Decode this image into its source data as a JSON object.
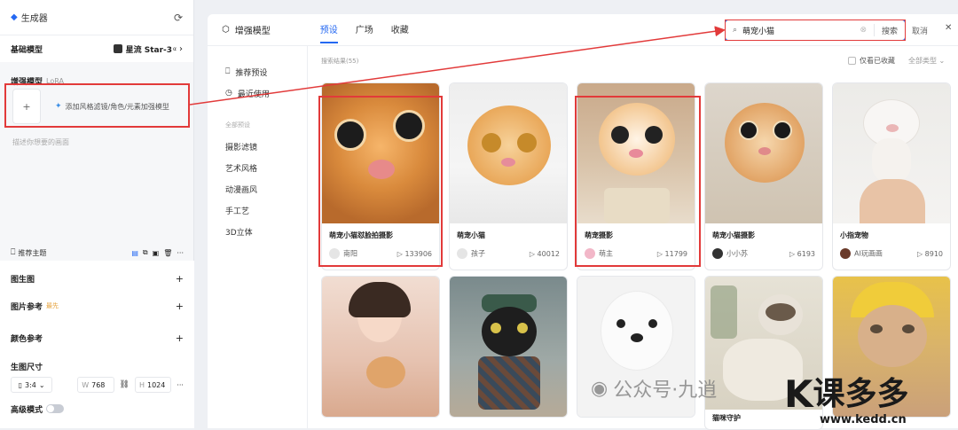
{
  "left_panel": {
    "title": "生成器",
    "base_model_label": "基础模型",
    "base_model_value": "星流 Star-3",
    "base_model_sup": "α",
    "enhance_label": "增强模型",
    "enhance_sub": "LoRA",
    "add_plus": "+",
    "add_model_text": "添加风格滤镜/角色/元素加强模型",
    "prompt_placeholder": "描述你想要的画面",
    "recommend_label": "推荐主题",
    "img2img_label": "图生图",
    "image_ref_label": "图片参考",
    "image_ref_badge": "最先",
    "color_ref_label": "颜色参考",
    "size_label": "生图尺寸",
    "ratio_value": "3:4",
    "w_label": "W",
    "w_value": "768",
    "h_label": "H",
    "h_value": "1024",
    "advanced_label": "高级模式",
    "more": "···"
  },
  "right_panel": {
    "title": "增强模型",
    "tabs": [
      {
        "label": "预设",
        "active": true
      },
      {
        "label": "广场",
        "active": false
      },
      {
        "label": "收藏",
        "active": false
      }
    ],
    "search_value": "萌宠小猫",
    "search_button": "搜索",
    "cancel": "取消",
    "close": "✕",
    "nav": [
      {
        "label": "推荐预设",
        "icon": "bookmark-icon"
      },
      {
        "label": "最近使用",
        "icon": "clock-icon"
      }
    ],
    "nav_group": "全部预设",
    "nav_sub": [
      "摄影滤镜",
      "艺术风格",
      "动漫画风",
      "手工艺",
      "3D立体"
    ],
    "result_count": "搜索结果(55)",
    "only_fav": "仅看已收藏",
    "type_filter": "全部类型"
  },
  "cards_row1": [
    {
      "name": "萌宠小猫怼脸拍摄影",
      "author": "南阳",
      "count": "133906"
    },
    {
      "name": "萌宠小猫",
      "author": "孩子",
      "count": "40012"
    },
    {
      "name": "萌宠摄影",
      "author": "萌主",
      "count": "11799"
    },
    {
      "name": "萌宠小猫摄影",
      "author": "小小苏",
      "count": "6193"
    },
    {
      "name": "小指宠物",
      "author": "AI玩画画",
      "count": "8910"
    }
  ],
  "cards_row2": [
    {
      "name": "",
      "author": "",
      "count": ""
    },
    {
      "name": "",
      "author": "",
      "count": ""
    },
    {
      "name": "",
      "author": "",
      "count": ""
    },
    {
      "name": "猫咪守护",
      "author": "",
      "count": ""
    },
    {
      "name": "",
      "author": "",
      "count": ""
    }
  ],
  "watermark": {
    "wechat": "公众号·九逍",
    "brand": "课多多",
    "url": "www.kedd.cn"
  },
  "colors": {
    "accent": "#2468f2",
    "highlight": "#e23a3a"
  }
}
